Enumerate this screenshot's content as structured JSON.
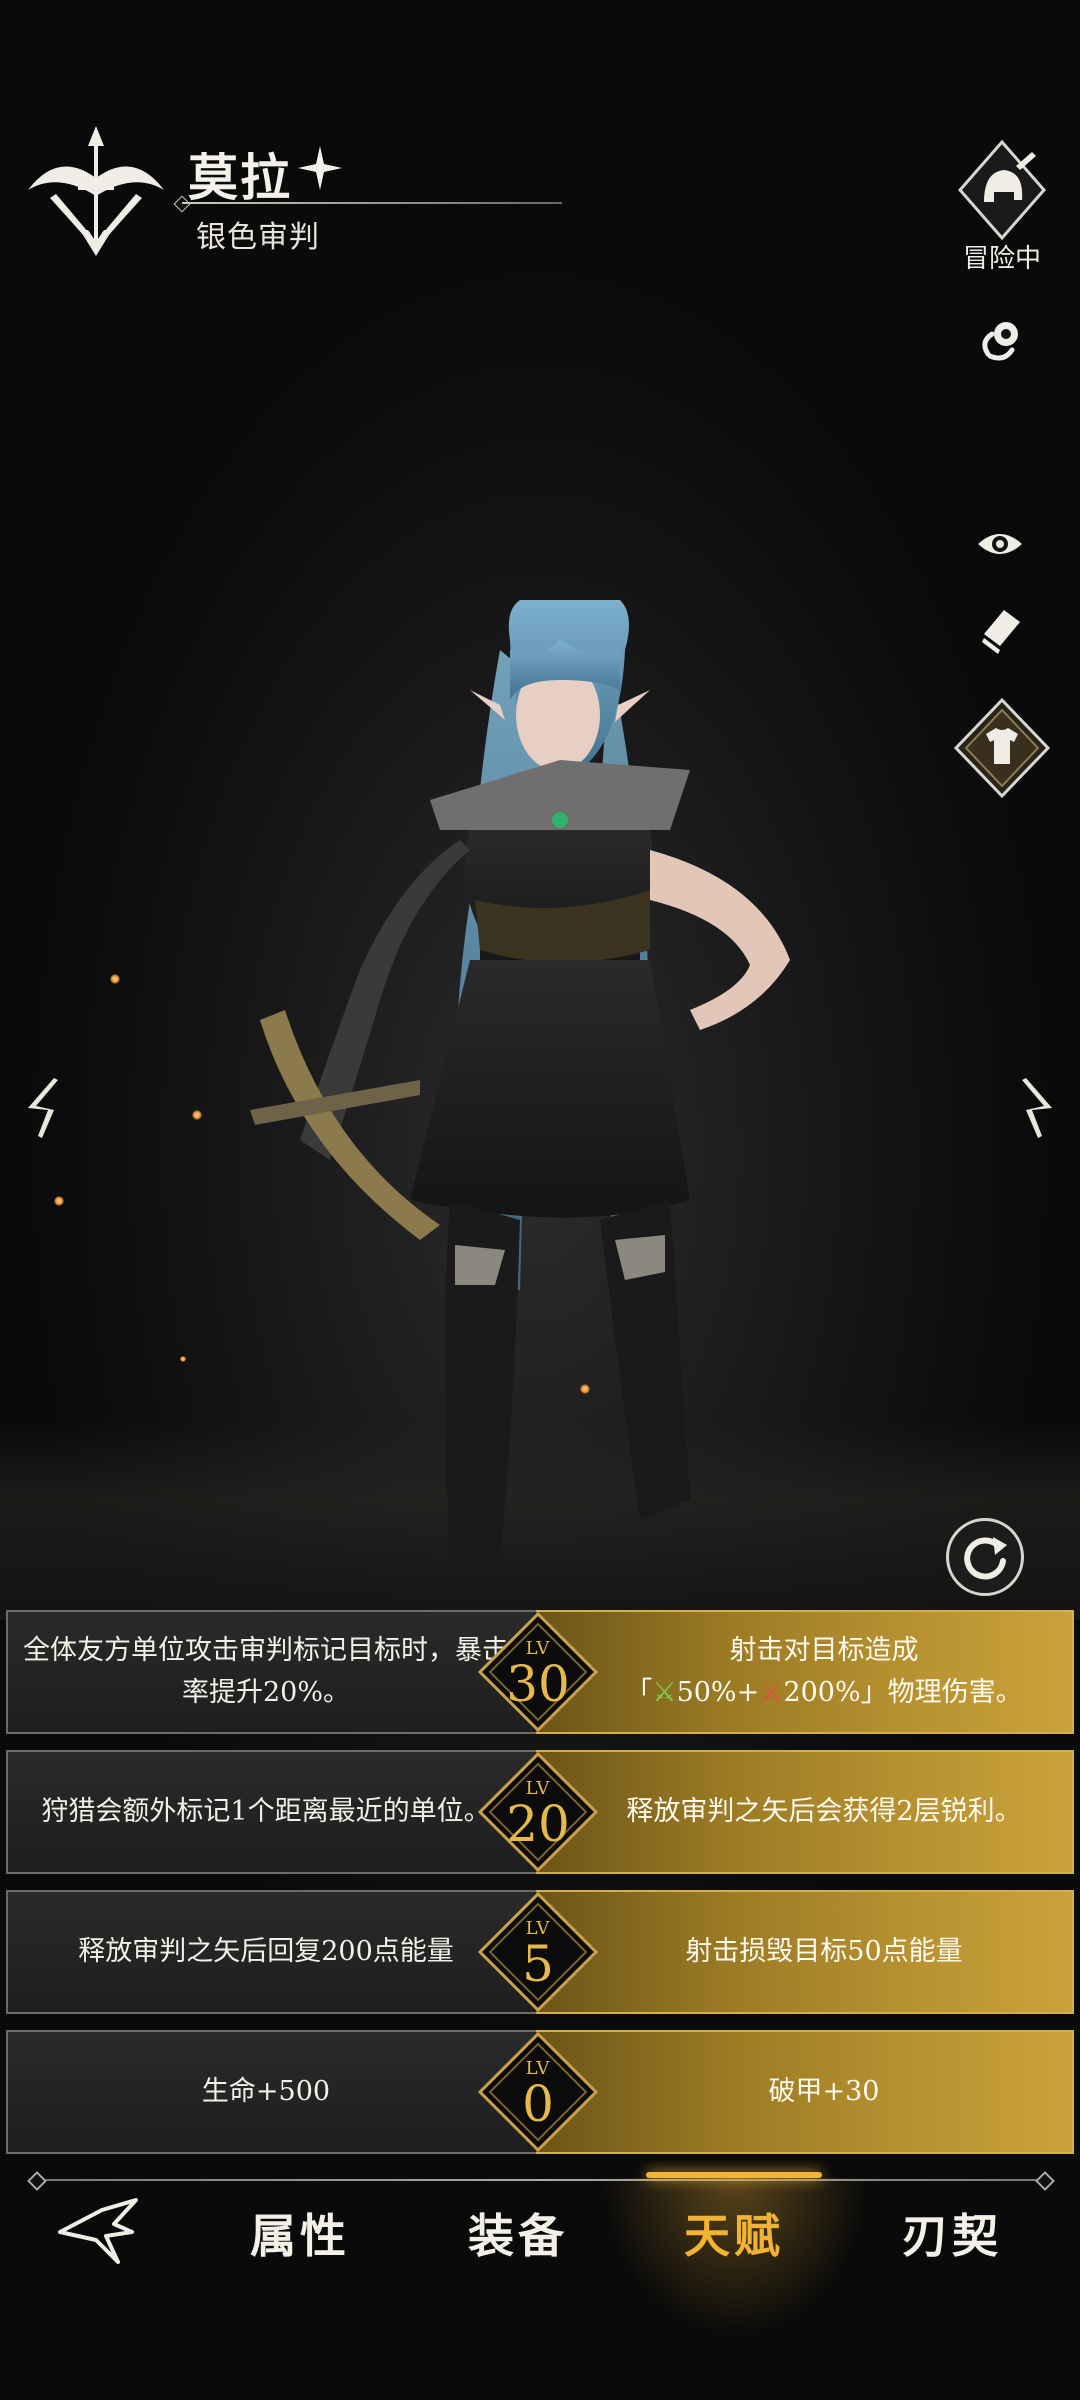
{
  "header": {
    "name": "莫拉",
    "title": "银色审判"
  },
  "side_buttons": {
    "adventure_label": "冒险中"
  },
  "talents": [
    {
      "level_label": "LV",
      "level": "30",
      "left_text": "全体友方单位攻击审判标记目标时，暴击率提升20%。",
      "right_line1": "射击对目标造成",
      "right_line2_pre": "「",
      "right_val1": "50%+",
      "right_val2": "200%",
      "right_line2_post": "」物理伤害。"
    },
    {
      "level_label": "LV",
      "level": "20",
      "left_text": "狩猎会额外标记1个距离最近的单位。",
      "right_text": "释放审判之矢后会获得2层锐利。"
    },
    {
      "level_label": "LV",
      "level": "5",
      "left_text": "释放审判之矢后回复200点能量",
      "right_text": "射击损毁目标50点能量"
    },
    {
      "level_label": "LV",
      "level": "0",
      "left_text": "生命+500",
      "right_text": "破甲+30"
    }
  ],
  "nav": {
    "items": [
      "属性",
      "装备",
      "天赋",
      "刃契"
    ],
    "active": "天赋"
  },
  "colors": {
    "accent_gold": "#f2b233",
    "panel_gold": "#b89231",
    "panel_dark": "#222222"
  }
}
